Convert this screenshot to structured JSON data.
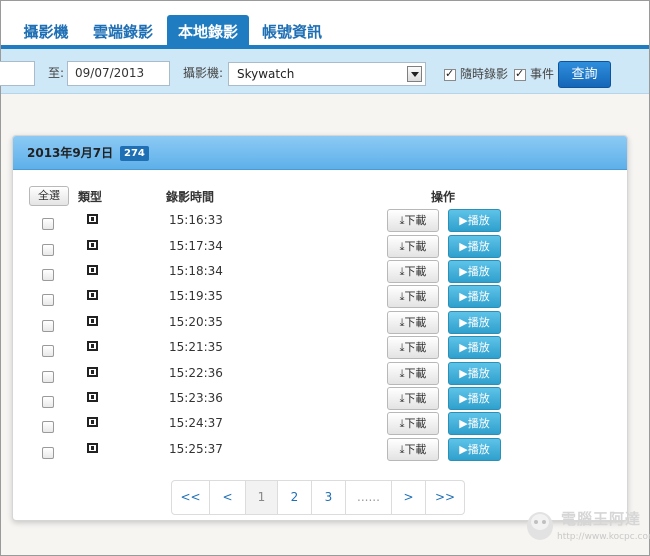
{
  "tabs": [
    {
      "label": "攝影機",
      "active": false
    },
    {
      "label": "雲端錄影",
      "active": false
    },
    {
      "label": "本地錄影",
      "active": true
    },
    {
      "label": "帳號資訊",
      "active": false
    }
  ],
  "filter": {
    "to_label": "至:",
    "to_date": "09/07/2013",
    "camera_label": "攝影機:",
    "camera_value": "Skywatch",
    "realtime_label": "隨時錄影",
    "realtime_checked": true,
    "event_label": "事件",
    "event_checked": true,
    "query_label": "查詢"
  },
  "panel": {
    "title": "2013年9月7日",
    "count": "274",
    "select_all_label": "全選",
    "col_type": "類型",
    "col_time": "錄影時間",
    "col_action": "操作",
    "download_label": "下載",
    "play_label": "播放",
    "rows": [
      {
        "time": "15:16:33"
      },
      {
        "time": "15:17:34"
      },
      {
        "time": "15:18:34"
      },
      {
        "time": "15:19:35"
      },
      {
        "time": "15:20:35"
      },
      {
        "time": "15:21:35"
      },
      {
        "time": "15:22:36"
      },
      {
        "time": "15:23:36"
      },
      {
        "time": "15:24:37"
      },
      {
        "time": "15:25:37"
      }
    ]
  },
  "pager": {
    "first": "<<",
    "prev": "<",
    "pages": [
      "1",
      "2",
      "3"
    ],
    "current": "1",
    "ellipsis": "......",
    "next": ">",
    "last": ">>"
  },
  "watermark": {
    "text": "電腦王阿達",
    "url": "http://www.kocpc.com.tw"
  },
  "colors": {
    "accent": "#1f7cc0",
    "filter_bg": "#cfe8f7",
    "panel_head": "#5eb0ea",
    "play_button": "#2fa0cd"
  }
}
